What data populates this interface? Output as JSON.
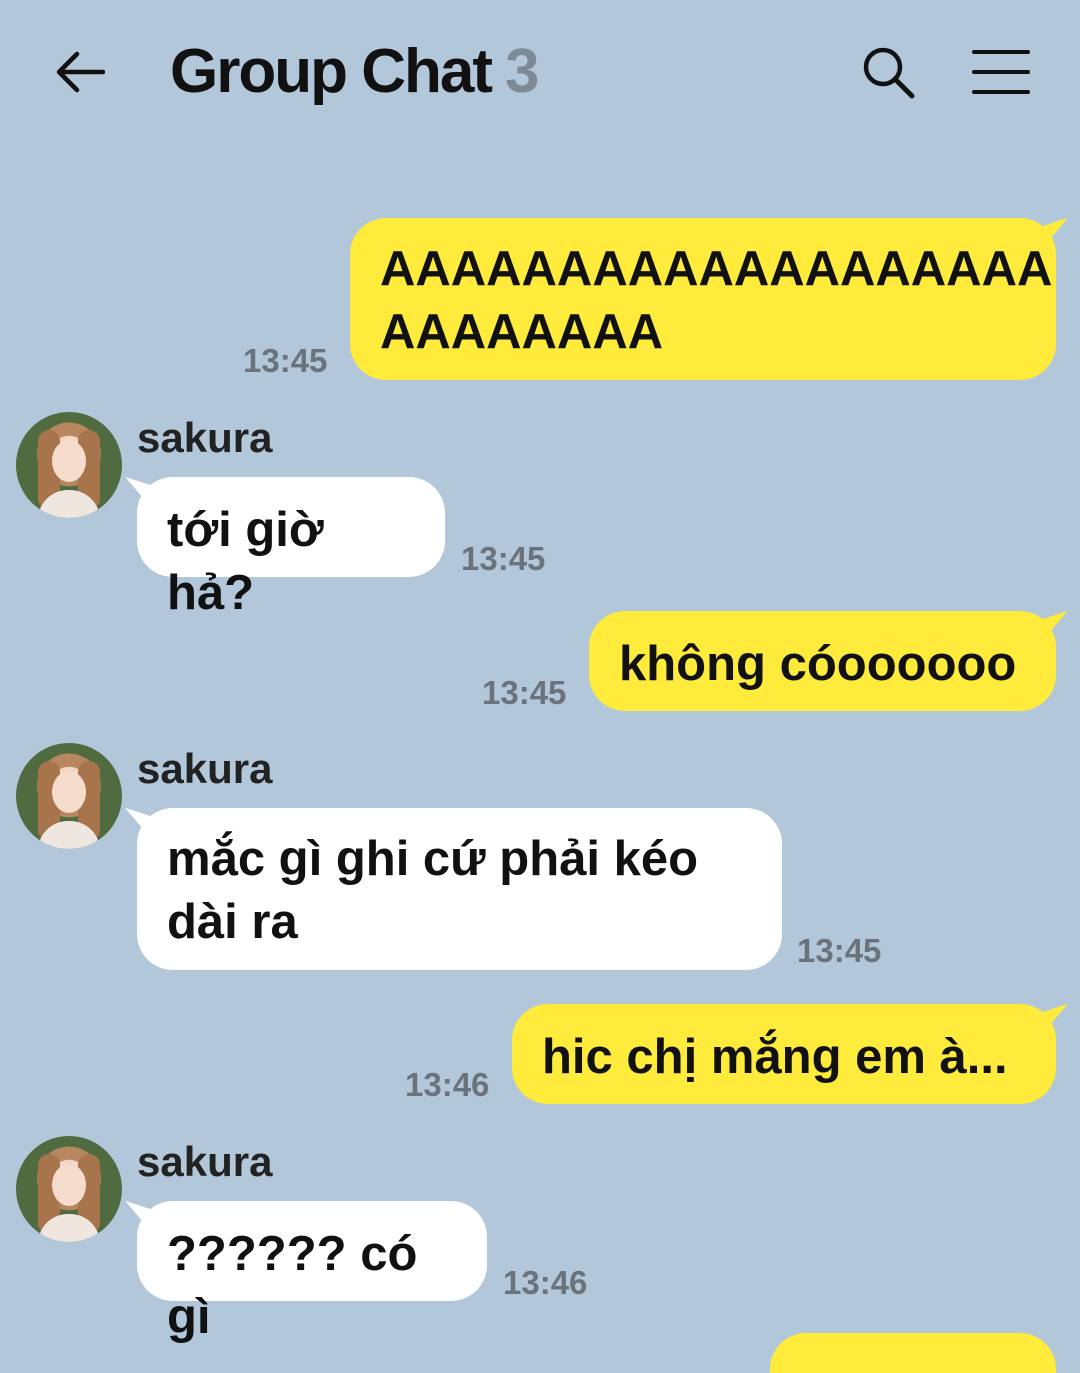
{
  "header": {
    "back_icon": "arrow-left-icon",
    "title": "Group Chat",
    "member_count": "3",
    "search_icon": "search-icon",
    "menu_icon": "hamburger-menu-icon"
  },
  "messages": [
    {
      "from": "me",
      "text": "AAAAAAAAAAAAAAAAAAA\nAAAAAAAA",
      "time": "13:45"
    },
    {
      "from": "sakura",
      "sender": "sakura",
      "text": "tới giờ hả?",
      "time": "13:45"
    },
    {
      "from": "me",
      "text": "không cóoooooo",
      "time": "13:45"
    },
    {
      "from": "sakura",
      "sender": "sakura",
      "text": "mắc gì ghi cứ phải kéo\ndài ra",
      "time": "13:45"
    },
    {
      "from": "me",
      "text": "hic chị mắng em à...",
      "time": "13:46"
    },
    {
      "from": "sakura",
      "sender": "sakura",
      "text": "?????? có gì",
      "time": "13:46"
    }
  ],
  "colors": {
    "background": "#b2c7d9",
    "my_bubble": "#ffeb3b",
    "their_bubble": "#ffffff",
    "timestamp": "#6a737c",
    "count": "#7d8a96"
  }
}
